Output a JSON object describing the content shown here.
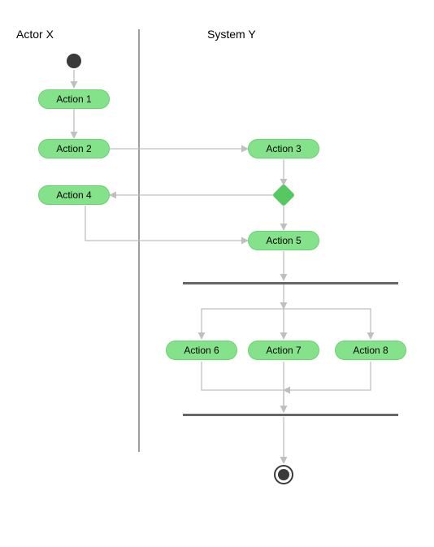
{
  "swimlanes": {
    "left": "Actor X",
    "right": "System Y"
  },
  "nodes": {
    "initial": "",
    "action1": "Action 1",
    "action2": "Action 2",
    "action3": "Action 3",
    "action4": "Action 4",
    "action5": "Action 5",
    "action6": "Action 6",
    "action7": "Action 7",
    "action8": "Action 8",
    "decision": "",
    "fork": "",
    "join": "",
    "final": ""
  },
  "edges": [
    "initial -> action1",
    "action1 -> action2",
    "action2 -> action3",
    "action3 -> decision",
    "decision -> action4",
    "decision -> action5",
    "action4 -> action5",
    "action5 -> fork",
    "fork -> action6",
    "fork -> action7",
    "fork -> action8",
    "action6 -> join",
    "action7 -> join",
    "action8 -> join",
    "join -> final"
  ]
}
